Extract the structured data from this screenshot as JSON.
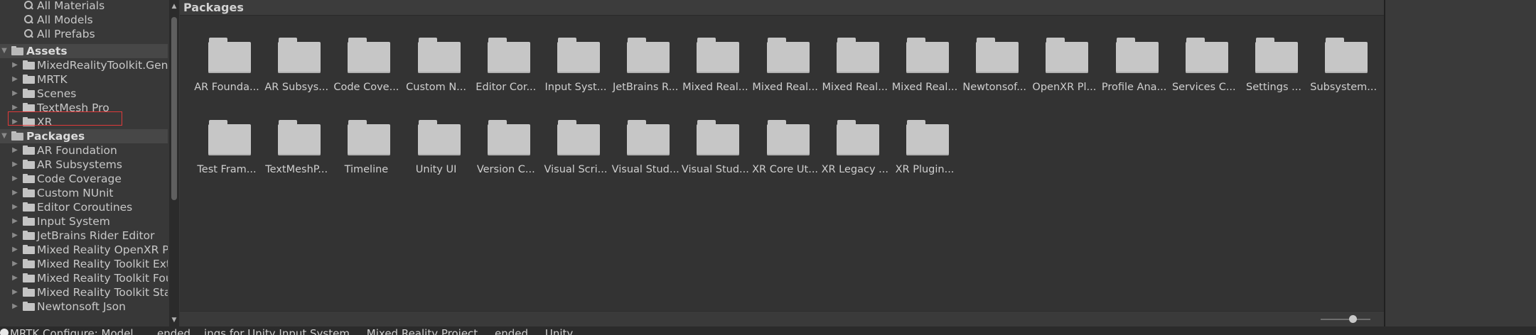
{
  "tree": {
    "favorites": [
      {
        "label": "All Materials"
      },
      {
        "label": "All Models"
      },
      {
        "label": "All Prefabs"
      }
    ],
    "assets_label": "Assets",
    "assets": [
      {
        "label": "MixedRealityToolkit.Gene"
      },
      {
        "label": "MRTK"
      },
      {
        "label": "Scenes"
      },
      {
        "label": "TextMesh Pro"
      },
      {
        "label": "XR"
      }
    ],
    "packages_label": "Packages",
    "packages": [
      {
        "label": "AR Foundation"
      },
      {
        "label": "AR Subsystems"
      },
      {
        "label": "Code Coverage"
      },
      {
        "label": "Custom NUnit"
      },
      {
        "label": "Editor Coroutines"
      },
      {
        "label": "Input System"
      },
      {
        "label": "JetBrains Rider Editor"
      },
      {
        "label": "Mixed Reality OpenXR P"
      },
      {
        "label": "Mixed Reality Toolkit Ext"
      },
      {
        "label": "Mixed Reality Toolkit Fou"
      },
      {
        "label": "Mixed Reality Toolkit Sta"
      },
      {
        "label": "Newtonsoft Json"
      }
    ]
  },
  "breadcrumb": {
    "label": "Packages",
    "chevron": "›"
  },
  "grid": [
    {
      "label": "AR Founda..."
    },
    {
      "label": "AR Subsys..."
    },
    {
      "label": "Code Cove..."
    },
    {
      "label": "Custom N..."
    },
    {
      "label": "Editor Cor..."
    },
    {
      "label": "Input Syst..."
    },
    {
      "label": "JetBrains R..."
    },
    {
      "label": "Mixed Real..."
    },
    {
      "label": "Mixed Real..."
    },
    {
      "label": "Mixed Real..."
    },
    {
      "label": "Mixed Real..."
    },
    {
      "label": "Newtonsof..."
    },
    {
      "label": "OpenXR Pl..."
    },
    {
      "label": "Profile Ana..."
    },
    {
      "label": "Services C..."
    },
    {
      "label": "Settings ..."
    },
    {
      "label": "Subsystem..."
    },
    {
      "label": "Test Fram..."
    },
    {
      "label": "TextMeshP..."
    },
    {
      "label": "Timeline"
    },
    {
      "label": "Unity UI"
    },
    {
      "label": "Version C..."
    },
    {
      "label": "Visual Scri..."
    },
    {
      "label": "Visual Stud..."
    },
    {
      "label": "Visual Stud..."
    },
    {
      "label": "XR Core Ut..."
    },
    {
      "label": "XR Legacy ..."
    },
    {
      "label": "XR Plugin..."
    }
  ],
  "zoom": {
    "level": 0.65
  },
  "colors": {
    "highlight": "#e03a3a",
    "folder": "#c6c6c6"
  },
  "status": {
    "message": "MRTK Configure: Model... ...ended ...ings for Unity Input System ... Mixed Reality Project ... ended ... Unity ..."
  }
}
